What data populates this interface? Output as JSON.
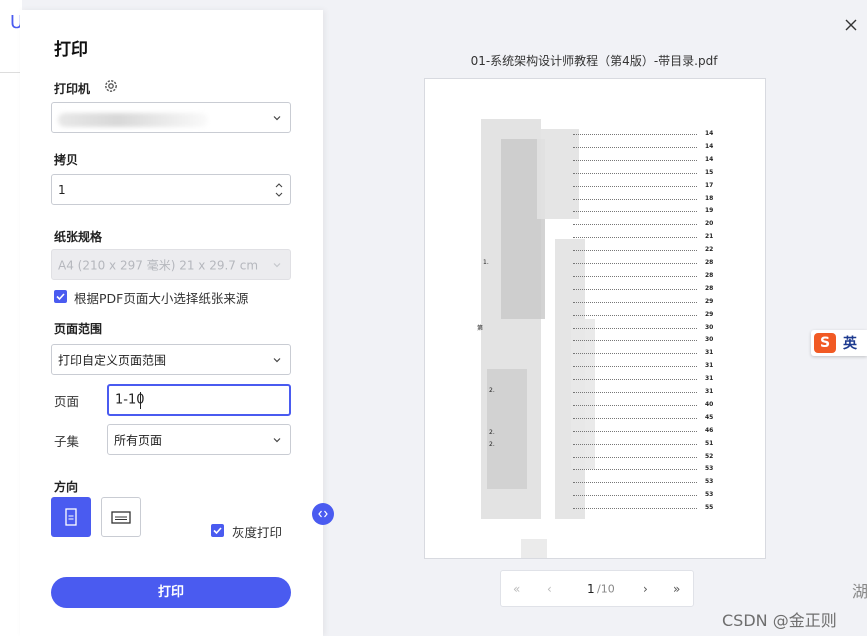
{
  "dialog": {
    "title": "打印",
    "printer": {
      "label": "打印机",
      "icon": "gear-icon",
      "value": ""
    },
    "copies": {
      "label": "拷贝",
      "value": "1"
    },
    "paper": {
      "label": "纸张规格",
      "value": "A4 (210 x 297 毫米) 21 x 29.7 cm",
      "disabled": true
    },
    "paper_source_checkbox": {
      "label": "根据PDF页面大小选择纸张来源",
      "checked": true
    },
    "page_range": {
      "label": "页面范围",
      "value": "打印自定义页面范围"
    },
    "pages": {
      "label": "页面",
      "value": "1-10"
    },
    "subset": {
      "label": "子集",
      "value": "所有页面"
    },
    "orientation": {
      "label": "方向",
      "selected": "portrait"
    },
    "grayscale_checkbox": {
      "label": "灰度打印",
      "checked": true
    },
    "print_button": "打印",
    "accent_color": "#4a5bf0"
  },
  "preview": {
    "document_title": "01-系统架构设计师教程（第4版）-带目录.pdf",
    "toc_page_numbers": [
      "14",
      "14",
      "14",
      "15",
      "17",
      "18",
      "19",
      "20",
      "21",
      "22",
      "28",
      "28",
      "28",
      "29",
      "29",
      "30",
      "30",
      "31",
      "31",
      "31",
      "31",
      "40",
      "45",
      "46",
      "51",
      "52",
      "53",
      "53",
      "53",
      "55"
    ],
    "toc_fragments": {
      "a": "1.",
      "b": "第",
      "c": "2.",
      "d": "2.",
      "e": "2."
    }
  },
  "pager": {
    "first": "«",
    "prev": "‹",
    "current": "1",
    "total": "/10",
    "next": "›",
    "last": "»"
  },
  "ime": {
    "lang": "英",
    "logo": "S"
  },
  "watermark": "CSDN @金正则",
  "edge_char": "湖"
}
